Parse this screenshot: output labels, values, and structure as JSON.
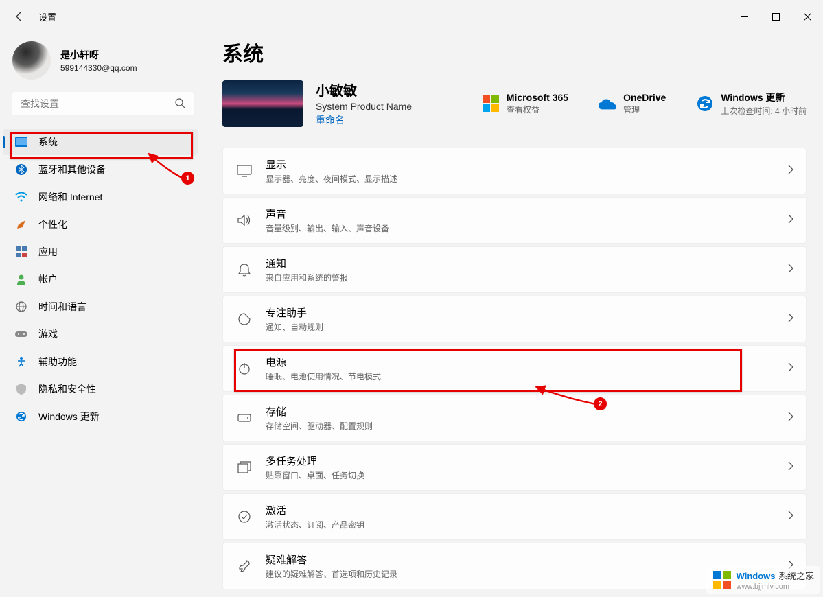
{
  "window": {
    "title": "设置"
  },
  "profile": {
    "name": "是小轩呀",
    "email": "599144330@qq.com"
  },
  "search": {
    "placeholder": "查找设置"
  },
  "nav": {
    "items": [
      {
        "label": "系统",
        "key": "system",
        "active": true,
        "icon": "monitor",
        "color": "#0078d4"
      },
      {
        "label": "蓝牙和其他设备",
        "key": "bluetooth",
        "icon": "bluetooth",
        "color": "#0067c0"
      },
      {
        "label": "网络和 Internet",
        "key": "network",
        "icon": "wifi",
        "color": "#0099e5"
      },
      {
        "label": "个性化",
        "key": "personalization",
        "icon": "brush",
        "color": "#d86c1f"
      },
      {
        "label": "应用",
        "key": "apps",
        "icon": "apps",
        "color": "#4a7bb0"
      },
      {
        "label": "帐户",
        "key": "accounts",
        "icon": "person",
        "color": "#4caf50"
      },
      {
        "label": "时间和语言",
        "key": "time",
        "icon": "globe",
        "color": "#666"
      },
      {
        "label": "游戏",
        "key": "gaming",
        "icon": "gamepad",
        "color": "#888"
      },
      {
        "label": "辅助功能",
        "key": "accessibility",
        "icon": "access",
        "color": "#0078d4"
      },
      {
        "label": "隐私和安全性",
        "key": "privacy",
        "icon": "shield",
        "color": "#999"
      },
      {
        "label": "Windows 更新",
        "key": "update",
        "icon": "sync",
        "color": "#0078d4"
      }
    ]
  },
  "page": {
    "title": "系统"
  },
  "pc": {
    "name": "小敏敏",
    "product": "System Product Name",
    "rename": "重命名"
  },
  "tiles": [
    {
      "key": "m365",
      "title": "Microsoft 365",
      "sub": "查看权益"
    },
    {
      "key": "onedrive",
      "title": "OneDrive",
      "sub": "管理"
    },
    {
      "key": "update",
      "title": "Windows 更新",
      "sub": "上次检查时间: 4 小时前"
    }
  ],
  "items": [
    {
      "key": "display",
      "title": "显示",
      "sub": "显示器、亮度、夜间模式、显示描述"
    },
    {
      "key": "sound",
      "title": "声音",
      "sub": "音量级别、输出、输入、声音设备"
    },
    {
      "key": "notifications",
      "title": "通知",
      "sub": "来自应用和系统的警报"
    },
    {
      "key": "focus",
      "title": "专注助手",
      "sub": "通知、自动规则"
    },
    {
      "key": "power",
      "title": "电源",
      "sub": "睡眠、电池使用情况、节电模式"
    },
    {
      "key": "storage",
      "title": "存储",
      "sub": "存储空间、驱动器、配置规则"
    },
    {
      "key": "multitask",
      "title": "多任务处理",
      "sub": "贴靠窗口、桌面、任务切换"
    },
    {
      "key": "activation",
      "title": "激活",
      "sub": "激活状态、订阅、产品密钥"
    },
    {
      "key": "troubleshoot",
      "title": "疑难解答",
      "sub": "建议的疑难解答、首选项和历史记录"
    }
  ],
  "annotations": {
    "badge1": "1",
    "badge2": "2"
  },
  "watermark": {
    "brand1": "Windows",
    "brand2": "系统之家",
    "url": "www.bjjmlv.com"
  }
}
